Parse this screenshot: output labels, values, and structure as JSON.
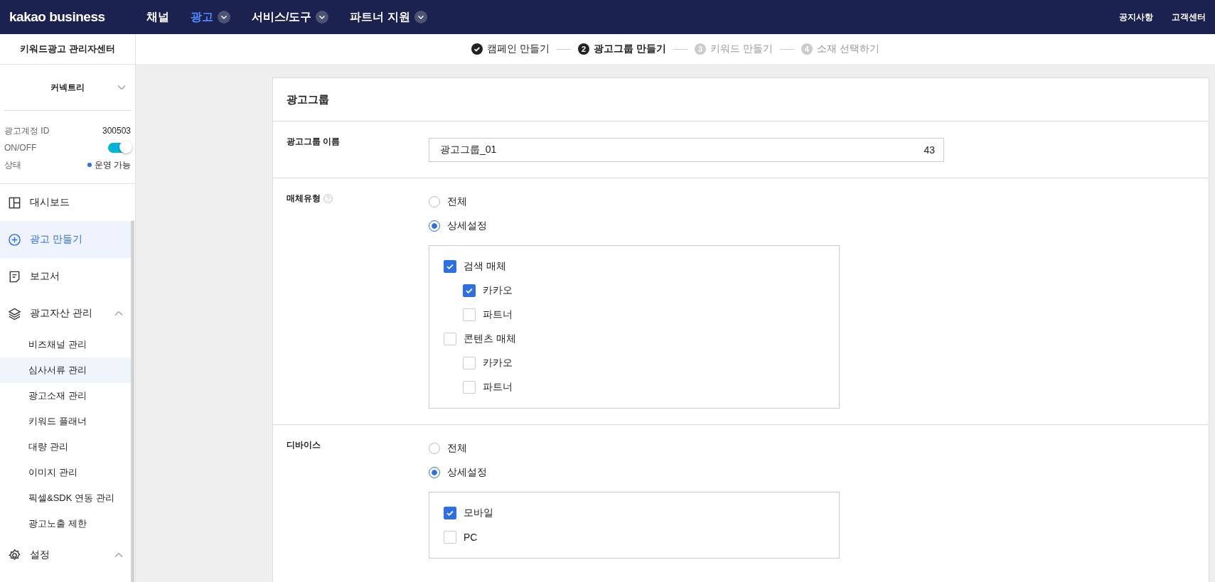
{
  "header": {
    "logo": "kakao business",
    "nav": [
      {
        "label": "채널",
        "selected": false,
        "dropdown": false
      },
      {
        "label": "광고",
        "selected": true,
        "dropdown": true
      },
      {
        "label": "서비스/도구",
        "selected": false,
        "dropdown": true
      },
      {
        "label": "파트너 지원",
        "selected": false,
        "dropdown": true
      }
    ],
    "links": [
      "공지사항",
      "고객센터"
    ]
  },
  "sidebar": {
    "title": "키워드광고 관리자센터",
    "account": "커넥트리",
    "info": [
      {
        "label": "광고계정 ID",
        "kind": "text",
        "value": "300503"
      },
      {
        "label": "ON/OFF",
        "kind": "toggle",
        "on": true
      },
      {
        "label": "상태",
        "kind": "status",
        "value": "운영 가능"
      }
    ],
    "items": [
      {
        "label": "대시보드",
        "selected": false
      },
      {
        "label": "광고 만들기",
        "selected": true
      },
      {
        "label": "보고서",
        "selected": false
      },
      {
        "label": "광고자산 관리",
        "selected": false,
        "expanded": true,
        "children": [
          {
            "label": "비즈채널 관리",
            "selected": false
          },
          {
            "label": "심사서류 관리",
            "selected": true
          },
          {
            "label": "광고소재 관리",
            "selected": false
          },
          {
            "label": "키워드 플래너",
            "selected": false
          },
          {
            "label": "대량 관리",
            "selected": false
          },
          {
            "label": "이미지 관리",
            "selected": false
          },
          {
            "label": "픽셀&SDK 연동 관리",
            "selected": false
          },
          {
            "label": "광고노출 제한",
            "selected": false
          }
        ]
      },
      {
        "label": "설정",
        "selected": false,
        "expanded": true
      }
    ]
  },
  "steps": [
    {
      "kind": "done",
      "label": "캠페인 만들기"
    },
    {
      "kind": "current",
      "number": "2",
      "label": "광고그룹 만들기"
    },
    {
      "kind": "todo",
      "number": "3",
      "label": "키워드 만들기"
    },
    {
      "kind": "todo",
      "number": "4",
      "label": "소재 선택하기"
    }
  ],
  "card": {
    "title": "광고그룹",
    "name_row": {
      "label": "광고그룹 이름",
      "value": "광고그룹_01",
      "count": "43"
    },
    "media_row": {
      "label": "매체유형",
      "help": true,
      "radios": [
        {
          "label": "전체",
          "selected": false
        },
        {
          "label": "상세설정",
          "selected": true
        }
      ],
      "checks": [
        {
          "label": "검색 매체",
          "checked": true,
          "children": [
            {
              "label": "카카오",
              "checked": true
            },
            {
              "label": "파트너",
              "checked": false
            }
          ]
        },
        {
          "label": "콘텐츠 매체",
          "checked": false,
          "children": [
            {
              "label": "카카오",
              "checked": false
            },
            {
              "label": "파트너",
              "checked": false
            }
          ]
        }
      ]
    },
    "device_row": {
      "label": "디바이스",
      "radios": [
        {
          "label": "전체",
          "selected": false
        },
        {
          "label": "상세설정",
          "selected": true
        }
      ],
      "checks": [
        {
          "label": "모바일",
          "checked": true
        },
        {
          "label": "PC",
          "checked": false
        }
      ]
    }
  }
}
